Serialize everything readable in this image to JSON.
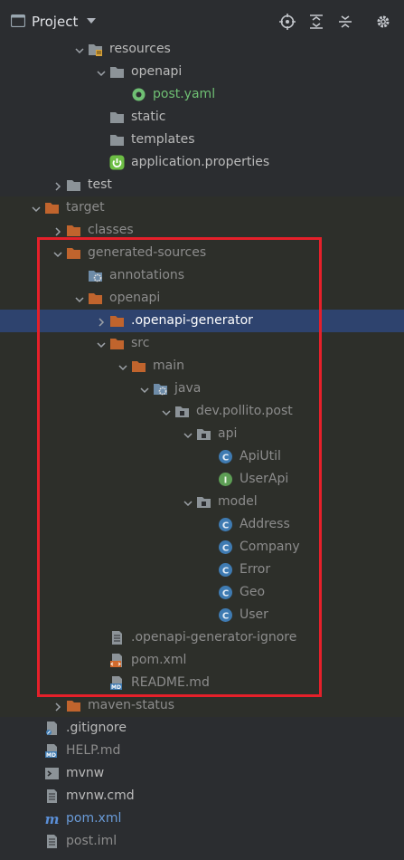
{
  "header": {
    "title": "Project",
    "tools": [
      "locate-icon",
      "expand-all-icon",
      "collapse-all-icon",
      "gear-icon"
    ]
  },
  "tree": [
    {
      "label": "resources",
      "icon": "resources-folder-icon",
      "level": 3,
      "expanded": true,
      "color": "normal"
    },
    {
      "label": "openapi",
      "icon": "folder-icon",
      "level": 4,
      "expanded": true,
      "color": "normal"
    },
    {
      "label": "post.yaml",
      "icon": "openapi-file-icon",
      "level": 5,
      "color": "green"
    },
    {
      "label": "static",
      "icon": "folder-icon",
      "level": 4,
      "color": "normal"
    },
    {
      "label": "templates",
      "icon": "folder-icon",
      "level": 4,
      "color": "normal"
    },
    {
      "label": "application.properties",
      "icon": "spring-icon",
      "level": 4,
      "color": "normal"
    },
    {
      "label": "test",
      "icon": "folder-icon",
      "level": 2,
      "collapsed": true,
      "color": "normal"
    },
    {
      "label": "target",
      "icon": "excluded-folder-icon",
      "level": 1,
      "expanded": true,
      "color": "gray",
      "dim": true
    },
    {
      "label": "classes",
      "icon": "excluded-folder-icon",
      "level": 2,
      "collapsed": true,
      "color": "gray",
      "dim": true
    },
    {
      "label": "generated-sources",
      "icon": "excluded-folder-icon",
      "level": 2,
      "expanded": true,
      "color": "gray",
      "dim": true
    },
    {
      "label": "annotations",
      "icon": "generated-sources-icon",
      "level": 3,
      "color": "gray",
      "dim": true
    },
    {
      "label": "openapi",
      "icon": "excluded-folder-icon",
      "level": 3,
      "expanded": true,
      "color": "gray",
      "dim": true
    },
    {
      "label": ".openapi-generator",
      "icon": "excluded-folder-icon",
      "level": 4,
      "collapsed": true,
      "color": "white",
      "selected": true
    },
    {
      "label": "src",
      "icon": "excluded-folder-icon",
      "level": 4,
      "expanded": true,
      "color": "gray",
      "dim": true
    },
    {
      "label": "main",
      "icon": "excluded-folder-icon",
      "level": 5,
      "expanded": true,
      "color": "gray",
      "dim": true
    },
    {
      "label": "java",
      "icon": "generated-sources-icon",
      "level": 6,
      "expanded": true,
      "color": "gray",
      "dim": true
    },
    {
      "label": "dev.pollito.post",
      "icon": "package-icon",
      "level": 7,
      "expanded": true,
      "color": "gray",
      "dim": true
    },
    {
      "label": "api",
      "icon": "package-icon",
      "level": 8,
      "expanded": true,
      "color": "gray",
      "dim": true
    },
    {
      "label": "ApiUtil",
      "icon": "class-icon",
      "level": 9,
      "color": "gray",
      "dim": true
    },
    {
      "label": "UserApi",
      "icon": "interface-icon",
      "level": 9,
      "color": "gray",
      "dim": true
    },
    {
      "label": "model",
      "icon": "package-icon",
      "level": 8,
      "expanded": true,
      "color": "gray",
      "dim": true
    },
    {
      "label": "Address",
      "icon": "class-icon",
      "level": 9,
      "color": "gray",
      "dim": true
    },
    {
      "label": "Company",
      "icon": "class-icon",
      "level": 9,
      "color": "gray",
      "dim": true
    },
    {
      "label": "Error",
      "icon": "class-icon",
      "level": 9,
      "color": "gray",
      "dim": true
    },
    {
      "label": "Geo",
      "icon": "class-icon",
      "level": 9,
      "color": "gray",
      "dim": true
    },
    {
      "label": "User",
      "icon": "class-icon",
      "level": 9,
      "color": "gray",
      "dim": true
    },
    {
      "label": ".openapi-generator-ignore",
      "icon": "text-file-icon",
      "level": 4,
      "color": "gray",
      "dim": true
    },
    {
      "label": "pom.xml",
      "icon": "xml-file-icon",
      "level": 4,
      "color": "gray",
      "dim": true
    },
    {
      "label": "README.md",
      "icon": "markdown-file-icon",
      "level": 4,
      "color": "gray",
      "dim": true
    },
    {
      "label": "maven-status",
      "icon": "excluded-folder-icon",
      "level": 2,
      "collapsed": true,
      "color": "gray",
      "dim": true
    },
    {
      "label": ".gitignore",
      "icon": "gitignore-file-icon",
      "level": 1,
      "color": "normal"
    },
    {
      "label": "HELP.md",
      "icon": "markdown-file-icon",
      "level": 1,
      "color": "gray"
    },
    {
      "label": "mvnw",
      "icon": "shell-file-icon",
      "level": 1,
      "color": "normal"
    },
    {
      "label": "mvnw.cmd",
      "icon": "text-file-icon",
      "level": 1,
      "color": "normal"
    },
    {
      "label": "pom.xml",
      "icon": "maven-file-icon",
      "level": 1,
      "color": "blue"
    },
    {
      "label": "post.iml",
      "icon": "text-file-icon",
      "level": 1,
      "color": "gray"
    }
  ]
}
